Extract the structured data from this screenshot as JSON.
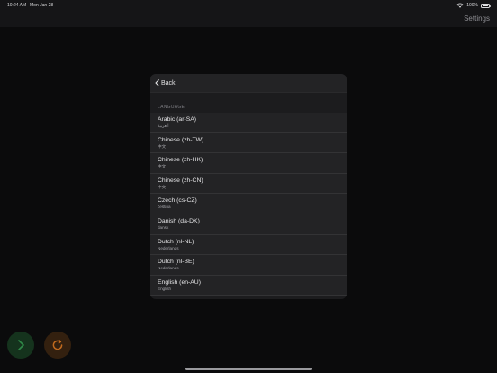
{
  "status_bar": {
    "time": "10:24 AM",
    "date": "Mon Jan 28",
    "battery": "100%"
  },
  "header": {
    "settings_label": "Settings"
  },
  "sheet": {
    "back_label": "Back",
    "section_label": "LANGUAGE",
    "languages": [
      {
        "name": "Arabic (ar-SA)",
        "native": "العربية"
      },
      {
        "name": "Chinese (zh-TW)",
        "native": "中文"
      },
      {
        "name": "Chinese (zh-HK)",
        "native": "中文"
      },
      {
        "name": "Chinese (zh-CN)",
        "native": "中文"
      },
      {
        "name": "Czech (cs-CZ)",
        "native": "čeština"
      },
      {
        "name": "Danish (da-DK)",
        "native": "dansk"
      },
      {
        "name": "Dutch (nl-NL)",
        "native": "Nederlands"
      },
      {
        "name": "Dutch (nl-BE)",
        "native": "Nederlands"
      },
      {
        "name": "English (en-AU)",
        "native": "English"
      }
    ]
  },
  "colors": {
    "background": "#0b0b0c",
    "sheet": "#1c1c1e",
    "row": "#232325",
    "go_button": "#2f8a48",
    "reset_button": "#c06a1e"
  },
  "icons": {
    "go": "chevron-right-icon",
    "reset": "refresh-icon",
    "back": "chevron-left-icon"
  }
}
